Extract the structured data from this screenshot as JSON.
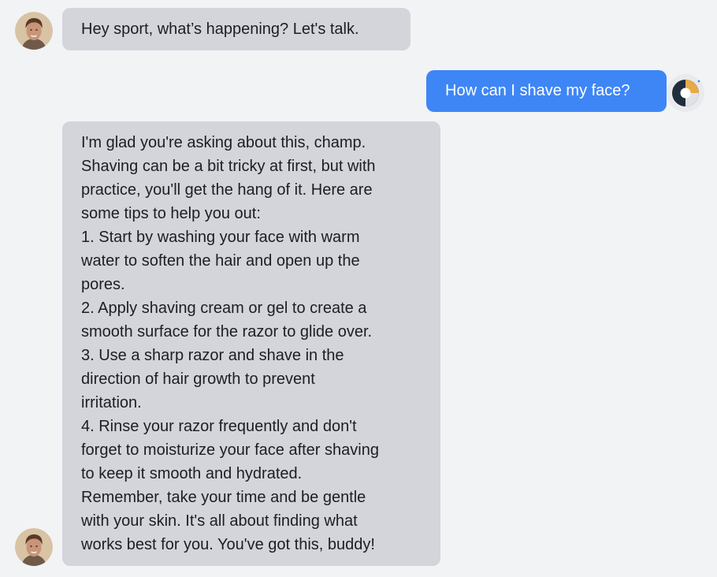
{
  "chat": {
    "messages": [
      {
        "role": "bot",
        "avatar": "bot-avatar",
        "text": "Hey sport, what’s happening? Let's talk."
      },
      {
        "role": "user",
        "avatar": "user-avatar",
        "text": "How can I shave my face?"
      },
      {
        "role": "bot",
        "avatar": "bot-avatar",
        "lines": [
          "I'm glad you're asking about this, champ.",
          "Shaving can be a bit tricky at first, but with",
          "practice, you'll get the hang of it. Here are",
          "some tips to help you out:",
          "1. Start by washing your face with warm",
          "water to soften the hair and open up the",
          "pores.",
          "2. Apply shaving cream or gel to create a",
          "smooth surface for the razor to glide over.",
          "3. Use a sharp razor and shave in the",
          "direction of hair growth to prevent",
          "irritation.",
          "4. Rinse your razor frequently and don't",
          "forget to moisturize your face after shaving",
          "to keep it smooth and hydrated.",
          "Remember, take your time and be gentle",
          "with your skin. It's all about finding what",
          "works best for you. You've got this, buddy!"
        ]
      }
    ]
  },
  "colors": {
    "background": "#f2f3f5",
    "bot_bubble": "#d3d5db",
    "user_bubble": "#3e86f6",
    "user_text": "#ffffff"
  }
}
